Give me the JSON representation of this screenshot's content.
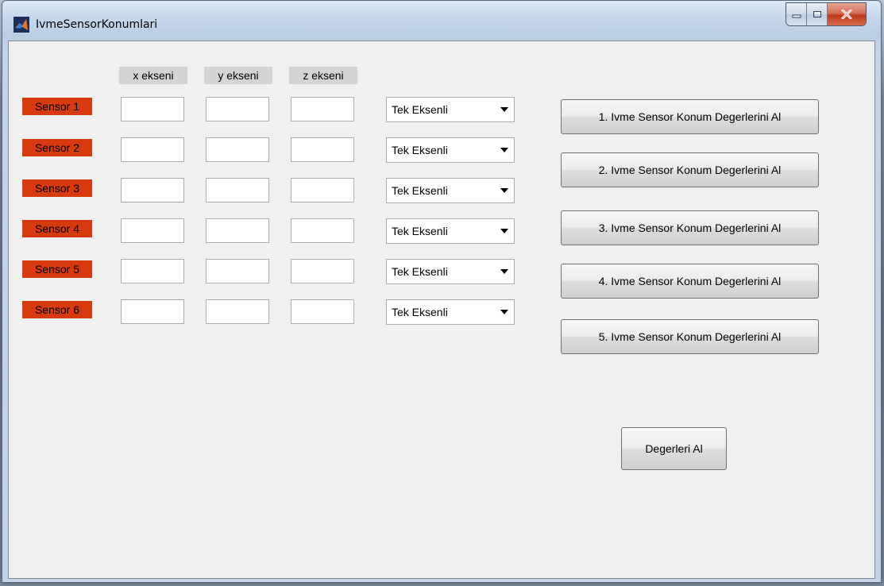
{
  "window": {
    "title": "IvmeSensorKonumlari",
    "app_icon": "matlab-icon",
    "controls": [
      "minimize-icon",
      "maximize-icon",
      "close-icon"
    ]
  },
  "headers": {
    "x": "x ekseni",
    "y": "y ekseni",
    "z": "z ekseni"
  },
  "sensors": [
    {
      "label": "Sensor 1",
      "x": "",
      "y": "",
      "z": "",
      "mode": "Tek Eksenli"
    },
    {
      "label": "Sensor 2",
      "x": "",
      "y": "",
      "z": "",
      "mode": "Tek Eksenli"
    },
    {
      "label": "Sensor 3",
      "x": "",
      "y": "",
      "z": "",
      "mode": "Tek Eksenli"
    },
    {
      "label": "Sensor 4",
      "x": "",
      "y": "",
      "z": "",
      "mode": "Tek Eksenli"
    },
    {
      "label": "Sensor 5",
      "x": "",
      "y": "",
      "z": "",
      "mode": "Tek Eksenli"
    },
    {
      "label": "Sensor 6",
      "x": "",
      "y": "",
      "z": "",
      "mode": "Tek Eksenli"
    }
  ],
  "buttons": [
    "1. Ivme Sensor Konum Degerlerini Al",
    "2. Ivme Sensor Konum Degerlerini Al",
    "3. Ivme Sensor Konum Degerlerini Al",
    "4. Ivme Sensor Konum Degerlerini Al",
    "5. Ivme Sensor Konum Degerlerini Al"
  ],
  "get_values_button": "Degerleri Al",
  "colors": {
    "sensor_label_bg": "#d63a0e",
    "header_bg": "#d4d4d4",
    "panel_bg": "#f0f0f0",
    "close_button": "#c0391c"
  }
}
